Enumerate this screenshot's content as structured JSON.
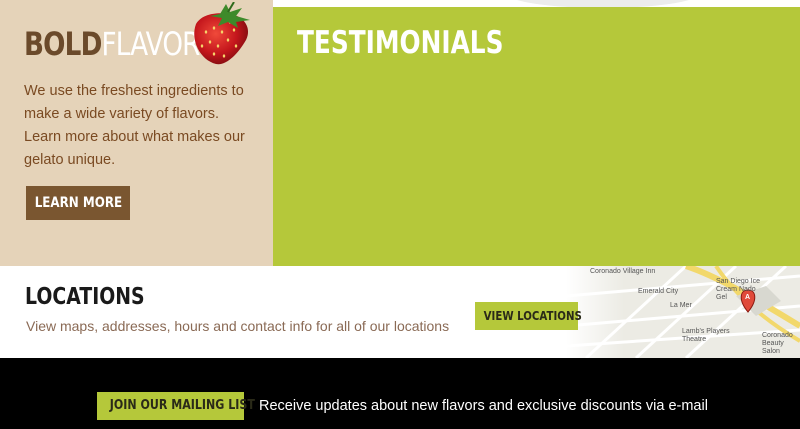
{
  "promo": {
    "title_bold": "BOLD",
    "title_light": "FLAVOR",
    "description": "We use the freshest ingredients to make a wide variety of flavors. Learn more about what makes our gelato unique.",
    "button_label": "LEARN MORE"
  },
  "testimonials": {
    "title": "TESTIMONIALS"
  },
  "locations": {
    "title": "LOCATIONS",
    "description": "View maps, addresses, hours and contact info for all of our locations",
    "button_label": "VIEW LOCATIONS",
    "map": {
      "labels": [
        "Coronado Village Inn",
        "Emerald City",
        "La Mer",
        "San Diego Ice Cream Nado Gel",
        "Lamb's Players Theatre",
        "Coronado Beauty Salon"
      ],
      "marker_letter": "A"
    }
  },
  "mailing": {
    "button_label": "JOIN OUR MAILING LIST",
    "description": "Receive updates about new flavors and exclusive discounts via e-mail"
  },
  "colors": {
    "accent_green": "#b5c83a",
    "promo_beige": "#e5d3b9",
    "brown": "#7a5630",
    "footer_black": "#000000"
  }
}
